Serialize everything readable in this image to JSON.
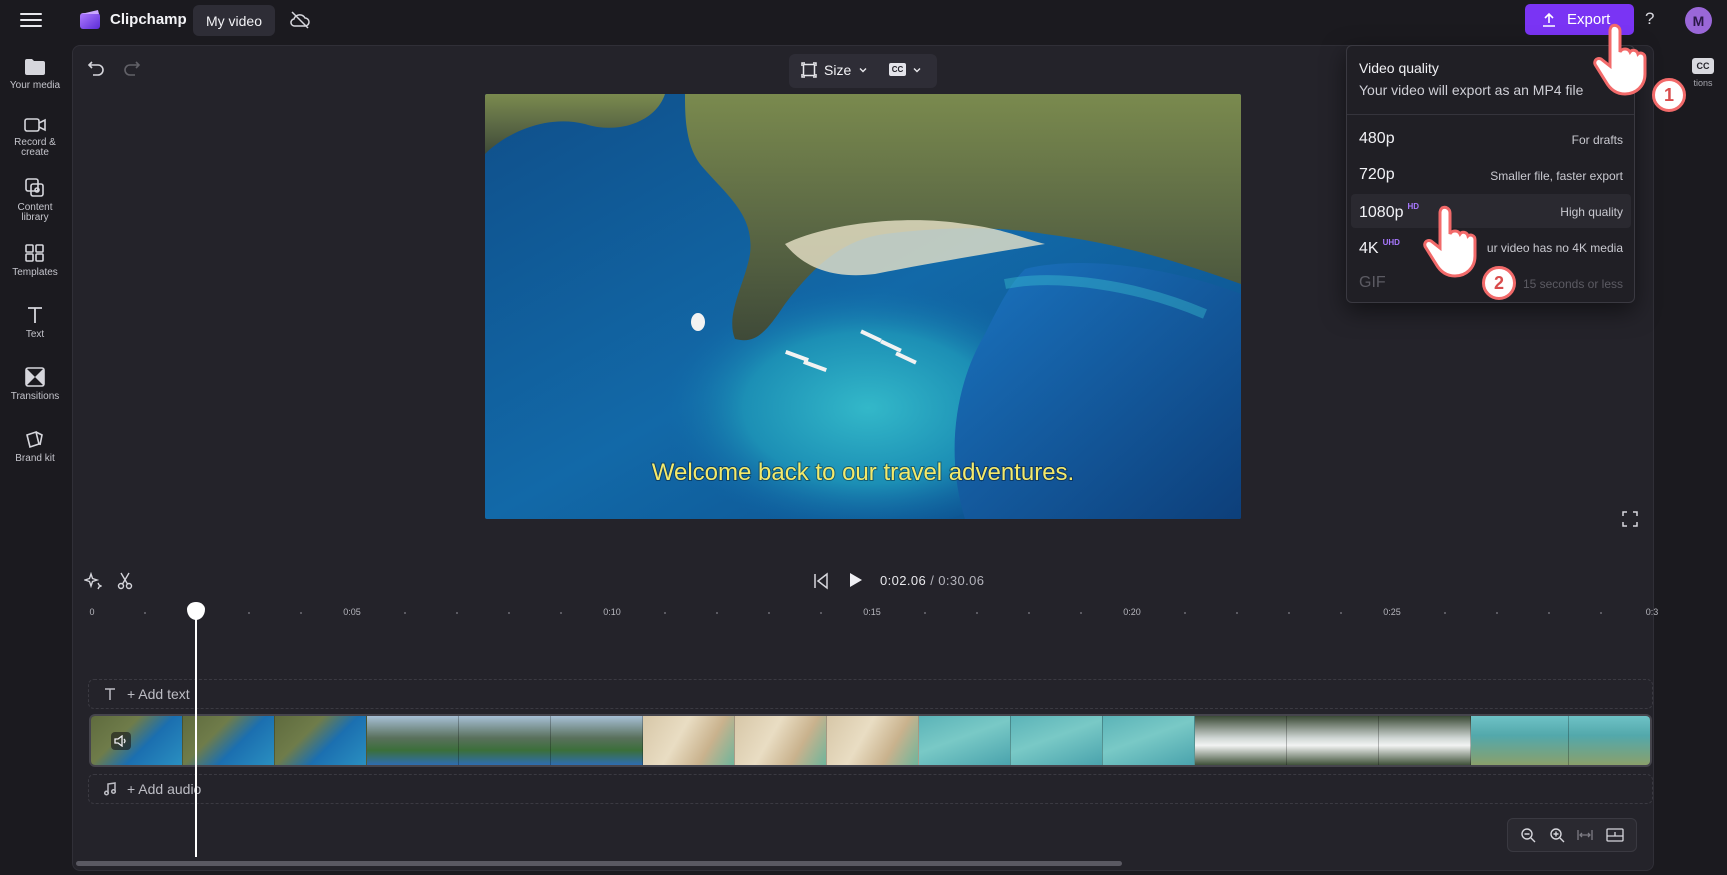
{
  "app": {
    "brand": "Clipchamp",
    "project_name": "My video",
    "export_label": "Export",
    "help_label": "?",
    "avatar_initial": "M"
  },
  "sidebar": {
    "items": [
      {
        "label": "Your media"
      },
      {
        "label": "Record & create"
      },
      {
        "label": "Content library"
      },
      {
        "label": "Templates"
      },
      {
        "label": "Text"
      },
      {
        "label": "Transitions"
      },
      {
        "label": "Brand kit"
      }
    ]
  },
  "toolbar": {
    "size_label": "Size",
    "cc_label": "CC"
  },
  "preview": {
    "caption": "Welcome back to our travel adventures."
  },
  "right_panel": {
    "captions_badge": "CC",
    "captions_label": "tions"
  },
  "export_menu": {
    "title": "Video quality",
    "subtitle": "Your video will export as an MP4 file",
    "options": [
      {
        "label": "480p",
        "badge": "",
        "desc": "For drafts",
        "enabled": true
      },
      {
        "label": "720p",
        "badge": "",
        "desc": "Smaller file, faster export",
        "enabled": true
      },
      {
        "label": "1080p",
        "badge": "HD",
        "desc": "High quality",
        "enabled": true
      },
      {
        "label": "4K",
        "badge": "UHD",
        "desc": "ur video has no 4K media",
        "enabled": true
      },
      {
        "label": "GIF",
        "badge": "",
        "desc": "15 seconds or less",
        "enabled": false
      }
    ]
  },
  "timeline": {
    "current_time": "0:02.06",
    "separator": " / ",
    "total_time": "0:30.06",
    "ruler_labels": [
      "0",
      "0:05",
      "0:10",
      "0:15",
      "0:20",
      "0:25",
      "0:3"
    ],
    "add_text_label": "+ Add text",
    "add_audio_label": "+ Add audio",
    "playhead_seconds": 2.06
  },
  "annotations": {
    "step1": "1",
    "step2": "2"
  },
  "colors": {
    "accent": "#7a34f4",
    "background": "#1b1a1f",
    "panel": "#24232a",
    "caption_text": "#f4e96a",
    "badge_purple": "#a878ff",
    "annotation_red": "#f26a6a"
  }
}
